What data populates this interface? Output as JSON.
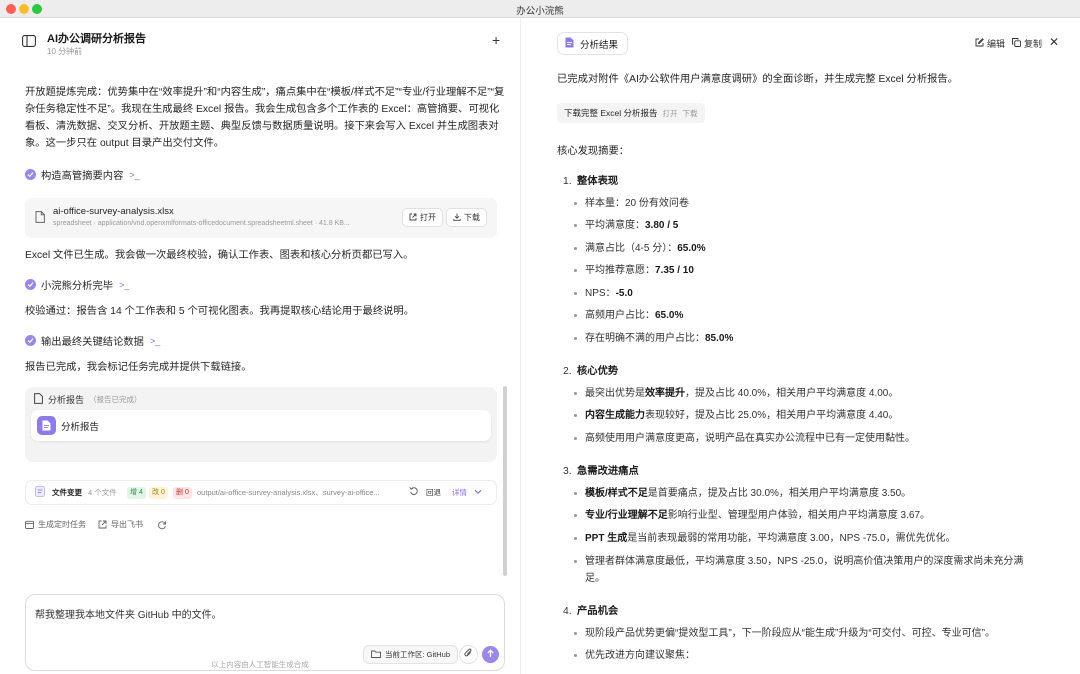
{
  "window": {
    "title": "办公小浣熊"
  },
  "chat": {
    "title": "AI办公调研分析报告",
    "subtitle": "10 分钟前",
    "messages": {
      "m1": "开放题提炼完成：优势集中在“效率提升”和“内容生成”，痛点集中在“模板/样式不足”“专业/行业理解不足”“复杂任务稳定性不足”。我现在生成最终 Excel 报告。我会生成包含多个工作表的 Excel：高管摘要、可视化看板、清洗数据、交叉分析、开放题主题、典型反馈与数据质量说明。接下来会写入 Excel 并生成图表对象。这一步只在 output 目录产出交付文件。",
      "m2": "Excel 文件已生成。我会做一次最终校验，确认工作表、图表和核心分析页都已写入。",
      "m3": "校验通过：报告含 14 个工作表和 5 个可视化图表。我再提取核心结论用于最终说明。",
      "m4": "报告已完成，我会标记任务完成并提供下载链接。"
    },
    "steps": {
      "s1": "构造高管摘要内容",
      "s2": "小浣熊分析完毕",
      "s3": "输出最终关键结论数据"
    },
    "file": {
      "name": "ai-office-survey-analysis.xlsx",
      "meta": "spreadsheet · application/vnd.openxmlformats-officedocument.spreadsheetml.sheet · 41.8 KB...",
      "open_label": "打开",
      "download_label": "下载"
    },
    "report": {
      "header": "分析报告",
      "status": "（报告已完成）",
      "card_label": "分析报告"
    },
    "changes": {
      "label": "文件变更",
      "count": "4 个文件",
      "added": "增 4",
      "modified": "改 0",
      "deleted": "删 0",
      "paths": "output/ai-office-survey-analysis.xlsx、survey-ai-office...",
      "rollback": "回退",
      "details": "详情"
    },
    "actions": {
      "schedule": "生成定时任务",
      "export": "导出飞书"
    },
    "composer": {
      "text": "帮我整理我本地文件夹 GitHub 中的文件。",
      "workspace": "当前工作区: GitHub"
    },
    "disclaimer": "以上内容由人工智能生成合成"
  },
  "panel": {
    "tab": "分析结果",
    "edit_label": "编辑",
    "copy_label": "复制",
    "intro": "已完成对附件《AI办公软件用户满意度调研》的全面诊断，并生成完整 Excel 分析报告。",
    "download": {
      "label": "下载完整 Excel 分析报告",
      "open": "打开",
      "download": "下载"
    },
    "summary_heading": "核心发现摘要：",
    "sections": {
      "s1": {
        "num": "1.",
        "title": "整体表现",
        "items": {
          "a": {
            "label": "样本量：",
            "value": "20 份有效问卷"
          },
          "b": {
            "label": "平均满意度：",
            "value": "3.80 / 5"
          },
          "c": {
            "label": "满意占比（4-5 分）：",
            "value": "65.0%"
          },
          "d": {
            "label": "平均推荐意愿：",
            "value": "7.35 / 10"
          },
          "e": {
            "label": "NPS：",
            "value": "-5.0"
          },
          "f": {
            "label": "高频用户占比：",
            "value": "65.0%"
          },
          "g": {
            "label": "存在明确不满的用户占比：",
            "value": "85.0%"
          }
        }
      },
      "s2": {
        "num": "2.",
        "title": "核心优势",
        "items": {
          "a": {
            "pre": "最突出优势是",
            "bold": "效率提升",
            "post": "，提及占比 40.0%，相关用户平均满意度 4.00。"
          },
          "b": {
            "bold": "内容生成能力",
            "post": "表现较好，提及占比 25.0%，相关用户平均满意度 4.40。"
          },
          "c": {
            "text": "高频使用用户满意度更高，说明产品在真实办公流程中已有一定使用黏性。"
          }
        }
      },
      "s3": {
        "num": "3.",
        "title": "急需改进痛点",
        "items": {
          "a": {
            "bold": "模板/样式不足",
            "post": "是首要痛点，提及占比 30.0%，相关用户平均满意度 3.50。"
          },
          "b": {
            "bold": "专业/行业理解不足",
            "post": "影响行业型、管理型用户体验，相关用户平均满意度 3.67。"
          },
          "c": {
            "bold": "PPT 生成",
            "post": "是当前表现最弱的常用功能，平均满意度 3.00，NPS -75.0，需优先优化。"
          },
          "d": {
            "text": "管理者群体满意度最低，平均满意度 3.50，NPS -25.0，说明高价值决策用户的深度需求尚未充分满足。"
          }
        }
      },
      "s4": {
        "num": "4.",
        "title": "产品机会",
        "items": {
          "a": {
            "text": "现阶段产品优势更偏“提效型工具”，下一阶段应从“能生成”升级为“可交付、可控、专业可信”。"
          },
          "b": {
            "text": "优先改进方向建议聚焦："
          }
        }
      }
    }
  },
  "colors": {
    "accent": "#9b87e8",
    "green_pill": "#e3f5e6",
    "yellow_pill": "#fdf3d6",
    "red_pill": "#fde4e4"
  }
}
